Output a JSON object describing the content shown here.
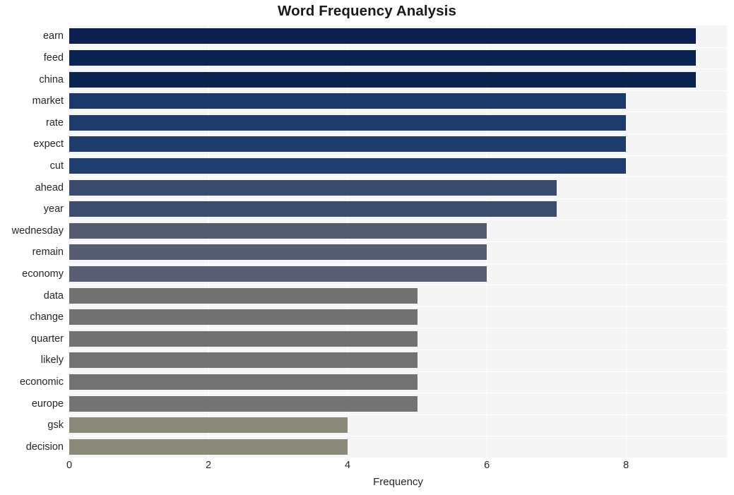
{
  "chart_data": {
    "type": "bar",
    "orientation": "horizontal",
    "title": "Word Frequency Analysis",
    "xlabel": "Frequency",
    "ylabel": "",
    "categories": [
      "earn",
      "feed",
      "china",
      "market",
      "rate",
      "expect",
      "cut",
      "ahead",
      "year",
      "wednesday",
      "remain",
      "economy",
      "data",
      "change",
      "quarter",
      "likely",
      "economic",
      "europe",
      "gsk",
      "decision"
    ],
    "values": [
      9,
      9,
      9,
      8,
      8,
      8,
      8,
      7,
      7,
      6,
      6,
      6,
      5,
      5,
      5,
      5,
      5,
      5,
      4,
      4
    ],
    "xlim": [
      0,
      9.45
    ],
    "ylim": [
      -0.5,
      19.5
    ],
    "x_ticks": [
      0,
      2,
      4,
      6,
      8
    ],
    "x_tick_labels": [
      "0",
      "2",
      "4",
      "6",
      "8"
    ],
    "grid": true,
    "grid_axis": "x",
    "legend": null,
    "bar_colors": [
      "#0b2050",
      "#0a2351",
      "#0a2450",
      "#1b3a6b",
      "#1d3c6d",
      "#1e3d6d",
      "#1f3e6e",
      "#394a6d",
      "#3b4c6f",
      "#545a70",
      "#565c71",
      "#575d72",
      "#6f7173",
      "#717172",
      "#717172",
      "#727273",
      "#727273",
      "#737373",
      "#8a8878",
      "#8b8979"
    ]
  },
  "style": {
    "plot_background": "#f5f5f5",
    "figure_background": "#ffffff",
    "gridline_color": "#ffffff",
    "text_color": "#262626"
  }
}
